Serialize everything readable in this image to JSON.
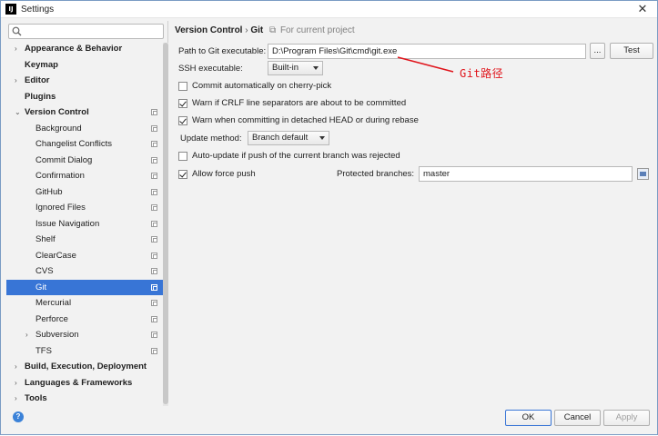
{
  "window": {
    "title": "Settings",
    "app_icon": "IJ"
  },
  "search": {
    "placeholder": ""
  },
  "sidebar": {
    "items": [
      {
        "label": "Appearance & Behavior",
        "bold": true,
        "arrow": "›",
        "project_icon": false
      },
      {
        "label": "Keymap",
        "bold": true,
        "arrow": "",
        "project_icon": false
      },
      {
        "label": "Editor",
        "bold": true,
        "arrow": "›",
        "project_icon": false
      },
      {
        "label": "Plugins",
        "bold": true,
        "arrow": "",
        "project_icon": false
      },
      {
        "label": "Version Control",
        "bold": true,
        "arrow": "⌄",
        "project_icon": true
      },
      {
        "label": "Background",
        "child": true,
        "project_icon": true
      },
      {
        "label": "Changelist Conflicts",
        "child": true,
        "project_icon": true
      },
      {
        "label": "Commit Dialog",
        "child": true,
        "project_icon": true
      },
      {
        "label": "Confirmation",
        "child": true,
        "project_icon": true
      },
      {
        "label": "GitHub",
        "child": true,
        "project_icon": true
      },
      {
        "label": "Ignored Files",
        "child": true,
        "project_icon": true
      },
      {
        "label": "Issue Navigation",
        "child": true,
        "project_icon": true
      },
      {
        "label": "Shelf",
        "child": true,
        "project_icon": true
      },
      {
        "label": "ClearCase",
        "child": true,
        "project_icon": true
      },
      {
        "label": "CVS",
        "child": true,
        "project_icon": true
      },
      {
        "label": "Git",
        "child": true,
        "project_icon": true,
        "selected": true
      },
      {
        "label": "Mercurial",
        "child": true,
        "project_icon": true
      },
      {
        "label": "Perforce",
        "child": true,
        "project_icon": true
      },
      {
        "label": "Subversion",
        "child": true,
        "arrow": "›",
        "project_icon": true
      },
      {
        "label": "TFS",
        "child": true,
        "project_icon": true
      },
      {
        "label": "Build, Execution, Deployment",
        "bold": true,
        "arrow": "›",
        "project_icon": false
      },
      {
        "label": "Languages & Frameworks",
        "bold": true,
        "arrow": "›",
        "project_icon": false
      },
      {
        "label": "Tools",
        "bold": true,
        "arrow": "›",
        "project_icon": false
      }
    ]
  },
  "breadcrumb": {
    "parent": "Version Control",
    "separator": "›",
    "current": "Git",
    "scope": "For current project"
  },
  "git": {
    "path_label": "Path to Git executable:",
    "path_value": "D:\\Program Files\\Git\\cmd\\git.exe",
    "browse_label": "...",
    "test_label": "Test",
    "ssh_label": "SSH executable:",
    "ssh_value": "Built-in",
    "cherry_pick_label": "Commit automatically on cherry-pick",
    "cherry_pick_checked": false,
    "crlf_label": "Warn if CRLF line separators are about to be committed",
    "crlf_checked": true,
    "detached_label": "Warn when committing in detached HEAD or during rebase",
    "detached_checked": true,
    "update_method_label": "Update method:",
    "update_method_value": "Branch default",
    "auto_update_label": "Auto-update if push of the current branch was rejected",
    "auto_update_checked": false,
    "force_push_label": "Allow force push",
    "force_push_checked": true,
    "protected_label": "Protected branches:",
    "protected_value": "master"
  },
  "annotation": {
    "text": "Git路径",
    "color": "#e0141b"
  },
  "footer": {
    "ok_label": "OK",
    "cancel_label": "Cancel",
    "apply_label": "Apply",
    "help_glyph": "?"
  },
  "colors": {
    "selection": "#3875d6",
    "border": "#7a9cc4"
  }
}
